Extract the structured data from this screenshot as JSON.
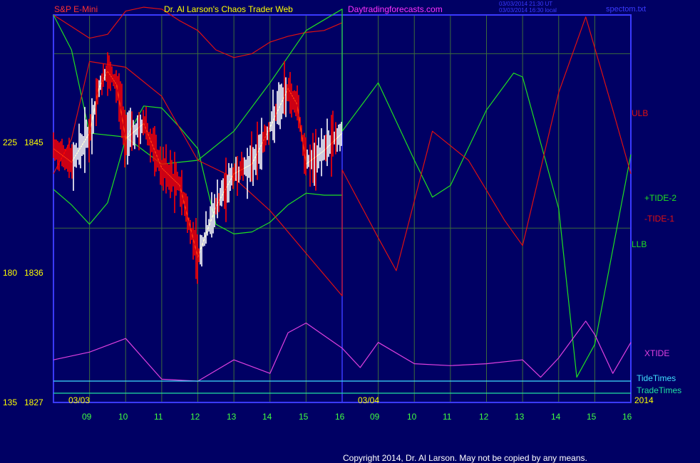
{
  "header": {
    "left": "S&P E-Mini",
    "title": "Dr. Al Larson's Chaos Trader Web",
    "site": "Daytradingforecasts.com",
    "stamp_1": "03/03/2014 21:30 UT",
    "stamp_2": "03/03/2014 16:30 local",
    "file": "spectom.txt"
  },
  "footer": {
    "copyright": "Copyright 2014, Dr. Al Larson. May not be copied by any means."
  },
  "y_axis": {
    "ticks": [
      {
        "a": "225",
        "b": "1845"
      },
      {
        "a": "180",
        "b": "1836"
      },
      {
        "a": "135",
        "b": "1827"
      }
    ]
  },
  "x_axis": {
    "hours_day1": [
      "09",
      "10",
      "11",
      "12",
      "13",
      "14",
      "15",
      "16"
    ],
    "hours_day2": [
      "09",
      "10",
      "11",
      "12",
      "13",
      "14",
      "15",
      "16"
    ],
    "date_1": "03/03",
    "date_2": "03/04",
    "year": "2014"
  },
  "legend": {
    "ulb": "ULB",
    "tide2": "+TIDE-2",
    "tide1": "-TIDE-1",
    "llb": "LLB",
    "xtide": "XTIDE",
    "tidetimes": "TideTimes",
    "tradetimes": "TradeTimes"
  },
  "colors": {
    "background": "#000064",
    "plot_border": "#3a3aff",
    "grid": "#3c6b3c",
    "header_red": "#ff3030",
    "header_yellow": "#ffff00",
    "header_magenta": "#ff30ff",
    "hour_green": "#40ff40",
    "tide1_red": "#e01010",
    "tide2_green": "#20e020",
    "xtide_magenta": "#e040e0",
    "cyan": "#40e0ff",
    "teal": "#20e0a0",
    "price_white": "#ffffff",
    "price_red": "#ff0000",
    "yellow_avg": "#ffff40",
    "footer_white": "#ffffff"
  },
  "chart_data": {
    "type": "line",
    "title": "",
    "xlabel": "",
    "ylabel": "",
    "ylim": [
      1827,
      1847
    ],
    "x_range": [
      "03/03 08:00",
      "03/04 16:00"
    ],
    "grid": true,
    "legend_placement": "right",
    "series": [
      {
        "name": "ULB",
        "x": [
          "03/03 08:00",
          "03/03 08:30",
          "03/03 09:00",
          "03/03 09:30",
          "03/03 10:00",
          "03/03 10:30",
          "03/03 11:00",
          "03/03 11:30",
          "03/03 12:00",
          "03/03 12:30",
          "03/03 13:00",
          "03/03 13:30",
          "03/03 14:00",
          "03/03 14:30",
          "03/03 15:00",
          "03/03 15:30",
          "03/03 16:00"
        ],
        "y": [
          1847.0,
          1846.4,
          1845.8,
          1846.0,
          1847.2,
          1847.4,
          1847.3,
          1846.7,
          1846.2,
          1845.2,
          1844.8,
          1845.0,
          1845.6,
          1845.9,
          1846.1,
          1846.2,
          1846.6
        ]
      },
      {
        "name": "LLB",
        "x": [
          "03/03 08:00",
          "03/03 08:30",
          "03/03 09:00",
          "03/03 09:30",
          "03/03 10:00",
          "03/03 10:30",
          "03/03 11:00",
          "03/03 11:30",
          "03/03 12:00",
          "03/03 12:30",
          "03/03 13:00",
          "03/03 13:30",
          "03/03 14:00",
          "03/03 14:30",
          "03/03 15:00",
          "03/03 15:30",
          "03/03 16:00"
        ],
        "y": [
          1838.0,
          1837.2,
          1836.2,
          1837.3,
          1840.6,
          1842.3,
          1842.2,
          1841.2,
          1840.1,
          1836.2,
          1835.7,
          1835.8,
          1836.3,
          1837.2,
          1837.8,
          1837.7,
          1837.7
        ]
      },
      {
        "name": "+TIDE-2",
        "x": [
          "03/03 08:00",
          "03/03 08:30",
          "03/03 09:00",
          "03/03 10:00",
          "03/03 11:00",
          "03/03 12:00",
          "03/03 13:00",
          "03/03 14:00",
          "03/03 15:00",
          "03/03 16:00",
          "03/04 08:00",
          "03/04 09:00",
          "03/04 10:00",
          "03/04 10:30",
          "03/04 11:00",
          "03/04 12:00",
          "03/04 12:45",
          "03/04 13:00",
          "03/04 14:00",
          "03/04 14:30",
          "03/04 15:00",
          "03/04 16:00"
        ],
        "y": [
          1847.0,
          1845.2,
          1840.9,
          1840.7,
          1839.3,
          1839.5,
          1841.0,
          1843.5,
          1846.2,
          1847.3,
          1841.0,
          1843.5,
          1839.5,
          1837.6,
          1838.2,
          1842.1,
          1844.0,
          1843.8,
          1837.0,
          1828.3,
          1830.0,
          1839.8
        ]
      },
      {
        "name": "-TIDE-1",
        "x": [
          "03/03 08:00",
          "03/03 08:30",
          "03/03 09:00",
          "03/03 10:00",
          "03/03 11:00",
          "03/03 12:00",
          "03/03 13:00",
          "03/03 14:00",
          "03/03 15:00",
          "03/03 16:00",
          "03/04 08:00",
          "03/04 09:00",
          "03/04 09:30",
          "03/04 10:30",
          "03/04 11:30",
          "03/04 12:30",
          "03/04 13:00",
          "03/04 14:00",
          "03/04 14:45",
          "03/04 15:30",
          "03/04 16:00"
        ],
        "y": [
          1838.8,
          1840.6,
          1844.6,
          1844.3,
          1842.8,
          1839.5,
          1838.6,
          1836.9,
          1834.7,
          1832.5,
          1839.0,
          1835.5,
          1833.8,
          1841.0,
          1839.5,
          1836.4,
          1835.1,
          1843.0,
          1846.9,
          1842.1,
          1838.8
        ]
      },
      {
        "name": "XTIDE",
        "x": [
          "03/03 08:00",
          "03/03 09:00",
          "03/03 10:00",
          "03/03 11:00",
          "03/03 12:00",
          "03/03 13:00",
          "03/03 14:00",
          "03/03 14:30",
          "03/03 15:00",
          "03/03 16:00",
          "03/04 08:30",
          "03/04 09:00",
          "03/04 10:00",
          "03/04 11:00",
          "03/04 12:00",
          "03/04 13:00",
          "03/04 13:30",
          "03/04 14:00",
          "03/04 14:45",
          "03/04 15:00",
          "03/04 15:30",
          "03/04 16:00"
        ],
        "y": [
          1829.2,
          1829.6,
          1830.3,
          1828.2,
          1828.1,
          1829.2,
          1828.5,
          1830.6,
          1831.1,
          1829.8,
          1828.8,
          1830.1,
          1829.0,
          1828.9,
          1829.0,
          1829.2,
          1828.3,
          1829.3,
          1831.2,
          1830.5,
          1828.5,
          1830.1
        ]
      }
    ],
    "price": {
      "name": "S&P E-Mini",
      "x": [
        "03/03 08:00",
        "03/03 08:30",
        "03/03 09:00",
        "03/03 09:15",
        "03/03 09:30",
        "03/03 09:45",
        "03/03 10:00",
        "03/03 10:30",
        "03/03 11:00",
        "03/03 11:30",
        "03/03 12:00",
        "03/03 12:30",
        "03/03 13:00",
        "03/03 13:30",
        "03/03 14:00",
        "03/03 14:30",
        "03/03 14:45",
        "03/03 15:00",
        "03/03 15:30",
        "03/03 16:00"
      ],
      "y": [
        1840.1,
        1839.4,
        1840.9,
        1843.2,
        1844.1,
        1843.4,
        1840.6,
        1841.4,
        1839.1,
        1838.2,
        1834.5,
        1837.1,
        1838.8,
        1839.3,
        1841.2,
        1843.2,
        1842.4,
        1839.3,
        1840.0,
        1840.9
      ]
    }
  }
}
